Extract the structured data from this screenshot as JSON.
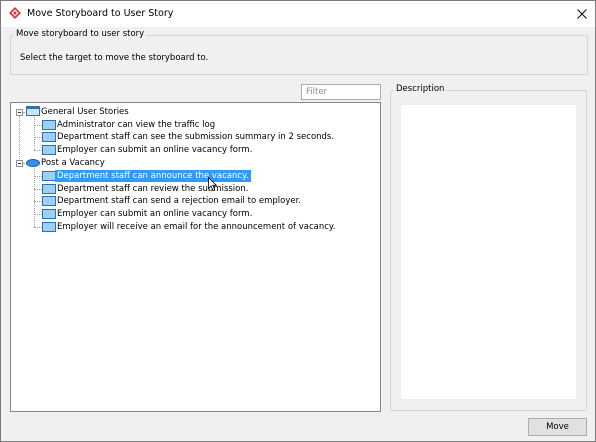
{
  "window": {
    "title": "Move Storyboard to User Story",
    "app_icon": "visual-paradigm-diamond-icon",
    "close_icon": "close-icon"
  },
  "header_group": {
    "legend": "Move storyboard to user story",
    "instructions": "Select the target to move the storyboard to."
  },
  "filter": {
    "placeholder": "Filter",
    "value": ""
  },
  "tree": {
    "groups": [
      {
        "label": "General User Stories",
        "icon": "user-story-group-icon",
        "expanded": true,
        "items": [
          {
            "label": "Administrator can view the traffic log",
            "icon": "user-story-icon",
            "selected": false
          },
          {
            "label": "Department staff can see the submission summary in 2 seconds.",
            "icon": "user-story-icon",
            "selected": false
          },
          {
            "label": "Employer can submit an online vacancy form.",
            "icon": "user-story-icon",
            "selected": false
          }
        ]
      },
      {
        "label": "Post a Vacancy",
        "icon": "use-case-icon",
        "expanded": true,
        "items": [
          {
            "label": "Department staff can announce the vacancy.",
            "icon": "user-story-icon",
            "selected": true
          },
          {
            "label": "Department staff can review the submission.",
            "icon": "user-story-icon",
            "selected": false
          },
          {
            "label": "Department staff can send a rejection email to employer.",
            "icon": "user-story-icon",
            "selected": false
          },
          {
            "label": "Employer can submit an online vacancy form.",
            "icon": "user-story-icon",
            "selected": false
          },
          {
            "label": "Employer will receive an email for the announcement of vacancy.",
            "icon": "user-story-icon",
            "selected": false
          }
        ]
      }
    ]
  },
  "description": {
    "legend": "Description",
    "text": ""
  },
  "actions": {
    "move_label": "Move"
  },
  "colors": {
    "selection": "#3399ff",
    "story_icon_fill": "#9cd0f5",
    "story_icon_stroke": "#2c6fb5",
    "usecase_fill": "#3a8ee8"
  }
}
